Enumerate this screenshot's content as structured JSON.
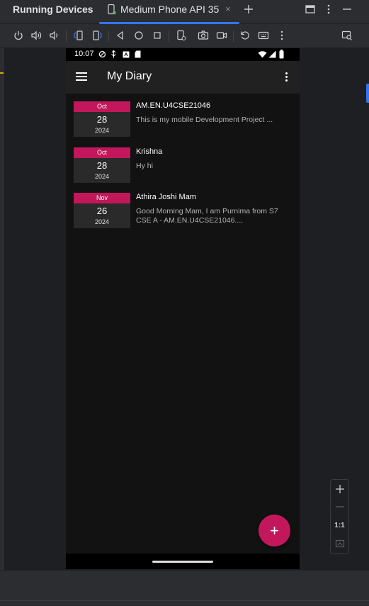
{
  "ide": {
    "tool_window_title": "Running Devices",
    "device_tab_label": "Medium Phone API 35",
    "device_tab_close": "×",
    "zoom_reset_label": "1:1",
    "accent_color": "#3574f0"
  },
  "toolbar": {
    "icons": [
      "power-icon",
      "volume-up-icon",
      "volume-down-icon",
      "rotate-left-icon",
      "rotate-right-icon",
      "back-icon",
      "home-icon",
      "overview-icon",
      "device-frame-icon",
      "screenshot-icon",
      "screen-record-icon",
      "reset-icon",
      "keyboard-icon",
      "more-icon",
      "inspect-icon"
    ]
  },
  "phone": {
    "status_time": "10:07",
    "app_title": "My Diary",
    "brand_color": "#c2185b",
    "fab_label": "+",
    "entries": [
      {
        "month": "Oct",
        "day": "28",
        "year": "2024",
        "title": "AM.EN.U4CSE21046",
        "body": "This is my mobile Development Project ..."
      },
      {
        "month": "Oct",
        "day": "28",
        "year": "2024",
        "title": "Krishna",
        "body": "Hy hi"
      },
      {
        "month": "Nov",
        "day": "26",
        "year": "2024",
        "title": "Athira Joshi Mam",
        "body": "Good Morning Mam, I am Purnima from S7 CSE A - AM.EN.U4CSE21046...."
      }
    ]
  }
}
